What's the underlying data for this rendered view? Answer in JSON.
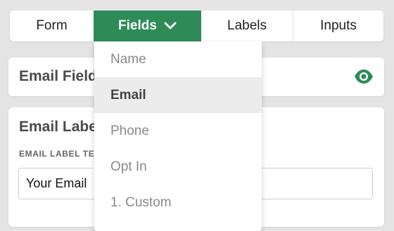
{
  "colors": {
    "accent": "#2e8b57",
    "eye_icon": "#2e8b57"
  },
  "tabs": [
    {
      "label": "Form",
      "active": false
    },
    {
      "label": "Fields",
      "active": true,
      "icon": "chevron-down-icon"
    },
    {
      "label": "Labels",
      "active": false
    },
    {
      "label": "Inputs",
      "active": false
    }
  ],
  "email_field_card": {
    "title": "Email Field",
    "icon": "eye-icon"
  },
  "email_label_card": {
    "title": "Email Label",
    "field_label": "EMAIL LABEL TEXT",
    "input_value": "Your Email"
  },
  "fields_menu": {
    "items": [
      {
        "label": "Name",
        "selected": false
      },
      {
        "label": "Email",
        "selected": true
      },
      {
        "label": "Phone",
        "selected": false
      },
      {
        "label": "Opt In",
        "selected": false
      },
      {
        "label": "1. Custom",
        "selected": false
      }
    ]
  }
}
